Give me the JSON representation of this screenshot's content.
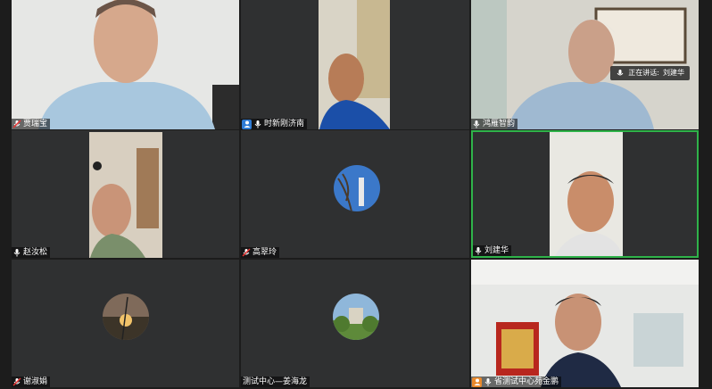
{
  "participants": [
    {
      "name": "贾瑞宝",
      "mic": "muted"
    },
    {
      "name": "时新刚济南",
      "mic": "on",
      "host": true
    },
    {
      "name": "鸿雁智韵",
      "mic": "on"
    },
    {
      "name": "赵汝松",
      "mic": "on"
    },
    {
      "name": "高翠玲",
      "mic": "muted"
    },
    {
      "name": "刘建华",
      "mic": "on",
      "speaking": true
    },
    {
      "name": "谢淑娟",
      "mic": "muted"
    },
    {
      "name": "测试中心—姜海龙",
      "mic": "none"
    },
    {
      "name": "省测试中心苑金鹏",
      "mic": "on",
      "host": true
    }
  ],
  "speaking_banner": {
    "label": "正在讲话:",
    "name": "刘建华"
  },
  "colors": {
    "tile_bg": "#2f3031",
    "speaking_border": "#2fb34a",
    "host_badge": "#2f7bd4"
  }
}
